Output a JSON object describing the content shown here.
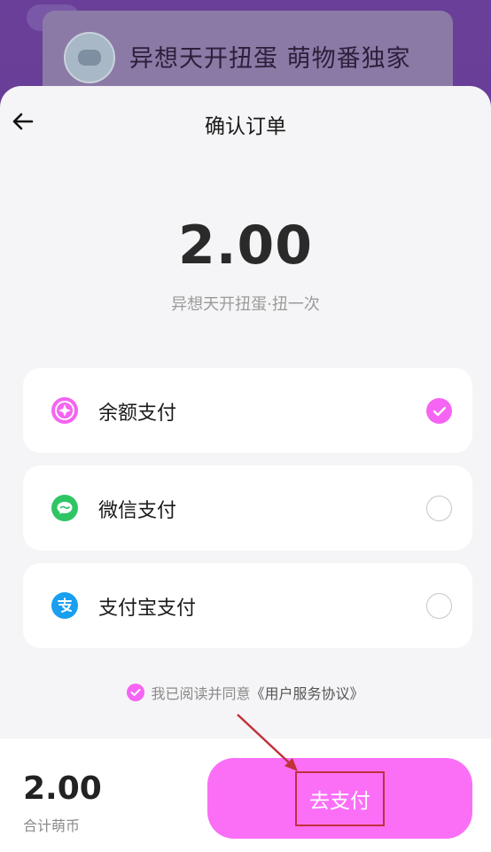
{
  "background": {
    "title": "异想天开扭蛋 萌物番独家"
  },
  "header": {
    "back_icon": "arrow-left-icon",
    "title": "确认订单"
  },
  "order": {
    "amount": "2.00",
    "product": "异想天开扭蛋·扭一次"
  },
  "payment_options": [
    {
      "label": "余额支付",
      "icon": "balance-coin-icon",
      "icon_color": "#f564f2",
      "checked": true
    },
    {
      "label": "微信支付",
      "icon": "wechat-icon",
      "icon_color": "#2fc565",
      "checked": false
    },
    {
      "label": "支付宝支付",
      "icon": "alipay-icon",
      "icon_color": "#1a9ff0",
      "checked": false
    }
  ],
  "agreement": {
    "prefix": "我已阅读并同意",
    "link": "《用户服务协议》",
    "checked": true
  },
  "footer": {
    "total": "2.00",
    "total_label": "合计萌币",
    "pay_button": "去支付"
  },
  "colors": {
    "accent": "#f564f2",
    "pay_button": "#fb6ff7",
    "annotation": "#c0313a"
  }
}
